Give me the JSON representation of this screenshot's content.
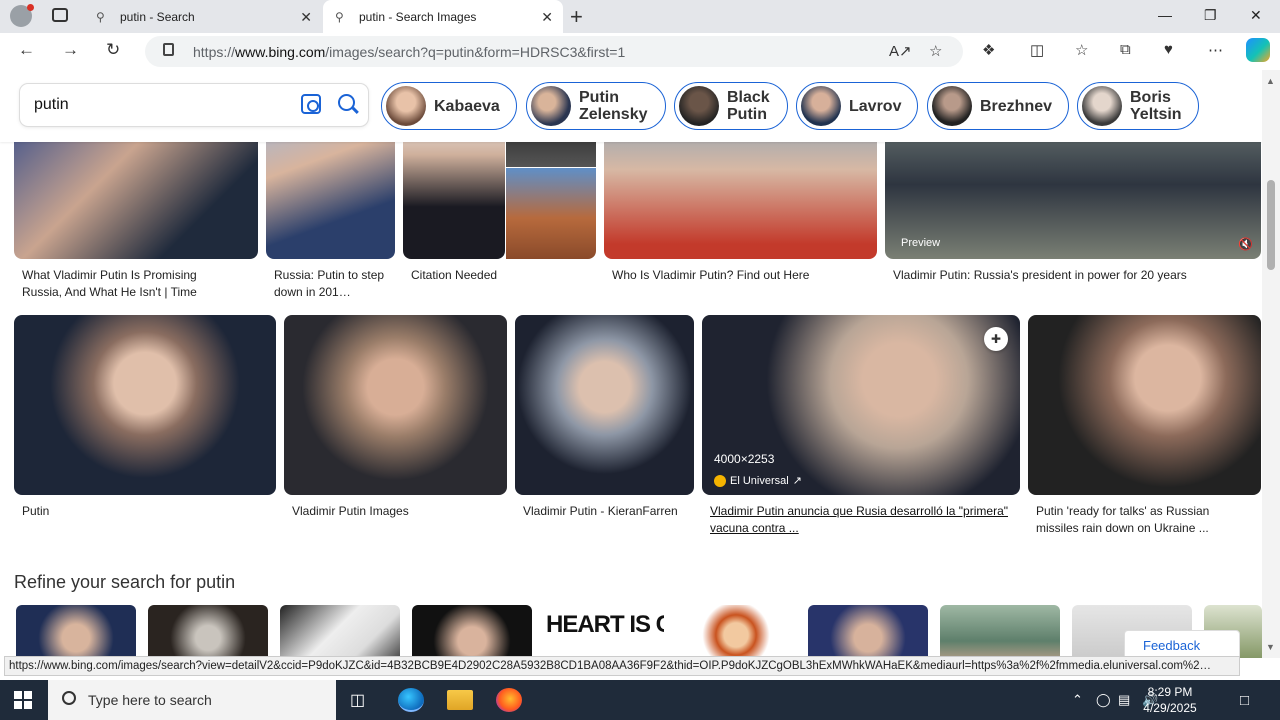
{
  "browser": {
    "tabs": [
      {
        "title": "putin - Search"
      },
      {
        "title": "putin - Search Images"
      }
    ],
    "url_prefix": "https://",
    "url_domain": "www.bing.com",
    "url_path": "/images/search?q=putin&form=HDRSC3&first=1"
  },
  "search": {
    "query": "putin"
  },
  "related_chips": [
    {
      "label": "Kabaeva"
    },
    {
      "label": "Putin Zelensky"
    },
    {
      "label": "Black Putin"
    },
    {
      "label": "Lavrov"
    },
    {
      "label": "Brezhnev"
    },
    {
      "label": "Boris Yeltsin"
    }
  ],
  "results_row1": [
    {
      "caption": "What Vladimir Putin Is Promising Russia, And What He Isn't | Time"
    },
    {
      "caption": "Russia: Putin to step down in 201…"
    },
    {
      "caption": "Citation Needed"
    },
    {
      "caption": "Who Is Vladimir Putin? Find out Here"
    },
    {
      "caption": "Vladimir Putin: Russia's president in power for 20 years",
      "overlay": "Preview"
    }
  ],
  "results_row2": [
    {
      "caption": "Putin"
    },
    {
      "caption": "Vladimir Putin Images"
    },
    {
      "caption": "Vladimir Putin - KieranFarren"
    },
    {
      "caption": "Vladimir Putin anuncia que Rusia desarrolló la \"primera\" vacuna contra ...",
      "dims": "4000×2253",
      "source": "El Universal"
    },
    {
      "caption": "Putin 'ready for talks' as Russian missiles rain down on Ukraine ..."
    }
  ],
  "refine": {
    "title": "Refine your search for putin",
    "thumb_text": "HEART IS CO"
  },
  "feedback_label": "Feedback",
  "status_url": "https://www.bing.com/images/search?view=detailV2&ccid=P9doKJZC&id=4B32BCB9E4D2902C28A5932B8CD1BA08AA36F9F2&thid=OIP.P9doKJZCgOBL3hExMWhkWAHaEK&mediaurl=https%3a%2f%2fmmedia.eluniversal.com%2…",
  "taskbar": {
    "search_placeholder": "Type here to search",
    "time": "8:29 PM",
    "date": "4/29/2025"
  },
  "colors": {
    "accent": "#1a63d6",
    "taskbar": "#1f2b3a"
  }
}
